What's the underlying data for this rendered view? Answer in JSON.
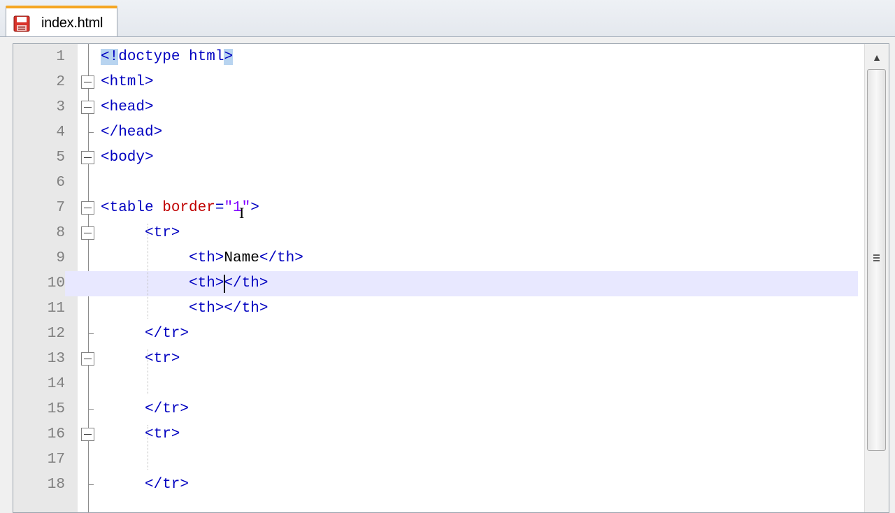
{
  "tab": {
    "label": "index.html",
    "icon": "save-disk-icon"
  },
  "lines": [
    {
      "n": "1",
      "fold": "none",
      "indent": 0,
      "tokens": [
        [
          "sel",
          "<!"
        ],
        [
          "tag",
          "doctype html"
        ],
        [
          "sel",
          ">"
        ]
      ]
    },
    {
      "n": "2",
      "fold": "box",
      "indent": 0,
      "tokens": [
        [
          "tag",
          "<html>"
        ]
      ]
    },
    {
      "n": "3",
      "fold": "box",
      "indent": 0,
      "tokens": [
        [
          "tag",
          "<head>"
        ]
      ]
    },
    {
      "n": "4",
      "fold": "tick",
      "indent": 0,
      "tokens": [
        [
          "tag",
          "</head>"
        ]
      ]
    },
    {
      "n": "5",
      "fold": "box",
      "indent": 0,
      "tokens": [
        [
          "tag",
          "<body>"
        ]
      ]
    },
    {
      "n": "6",
      "fold": "line",
      "indent": 0,
      "tokens": []
    },
    {
      "n": "7",
      "fold": "box",
      "indent": 0,
      "tokens": [
        [
          "tag",
          "<table "
        ],
        [
          "attr",
          "border"
        ],
        [
          "tag",
          "="
        ],
        [
          "str",
          "\"1\""
        ],
        [
          "tag",
          ">"
        ]
      ]
    },
    {
      "n": "8",
      "fold": "box",
      "indent": 1,
      "tokens": [
        [
          "tag",
          "<tr>"
        ]
      ]
    },
    {
      "n": "9",
      "fold": "line",
      "indent": 2,
      "tokens": [
        [
          "tag",
          "<th>"
        ],
        [
          "txt",
          "Name"
        ],
        [
          "tag",
          "</th>"
        ]
      ]
    },
    {
      "n": "10",
      "fold": "line",
      "indent": 2,
      "tokens": [
        [
          "tag",
          "<th>"
        ],
        [
          "tag",
          "</th>"
        ]
      ],
      "current": true
    },
    {
      "n": "11",
      "fold": "line",
      "indent": 2,
      "tokens": [
        [
          "tag",
          "<th>"
        ],
        [
          "tag",
          "</th>"
        ]
      ]
    },
    {
      "n": "12",
      "fold": "tick",
      "indent": 1,
      "tokens": [
        [
          "tag",
          "</tr>"
        ]
      ]
    },
    {
      "n": "13",
      "fold": "box",
      "indent": 1,
      "tokens": [
        [
          "tag",
          "<tr>"
        ]
      ]
    },
    {
      "n": "14",
      "fold": "line",
      "indent": 1,
      "tokens": []
    },
    {
      "n": "15",
      "fold": "tick",
      "indent": 1,
      "tokens": [
        [
          "tag",
          "</tr>"
        ]
      ]
    },
    {
      "n": "16",
      "fold": "box",
      "indent": 1,
      "tokens": [
        [
          "tag",
          "<tr>"
        ]
      ]
    },
    {
      "n": "17",
      "fold": "line",
      "indent": 1,
      "tokens": []
    },
    {
      "n": "18",
      "fold": "tick",
      "indent": 1,
      "tokens": [
        [
          "tag",
          "</tr>"
        ]
      ]
    }
  ],
  "colors": {
    "tag": "#0000c0",
    "attribute": "#c00000",
    "string": "#8000ff",
    "current_line": "#e8e8ff",
    "selection": "#b8d4f0",
    "tab_accent": "#f5a623"
  }
}
